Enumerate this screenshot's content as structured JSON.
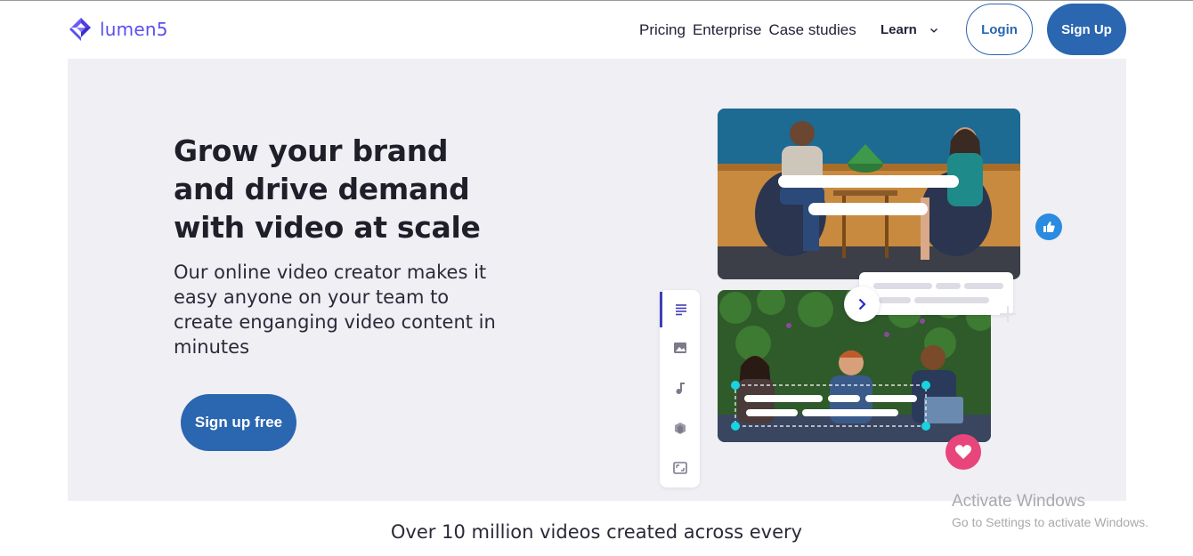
{
  "brand": {
    "name": "lumen5",
    "color": "#5a4ff2"
  },
  "nav": {
    "links": [
      "Pricing",
      "Enterprise",
      "Case studies"
    ],
    "learn": "Learn",
    "login": "Login",
    "signup": "Sign Up"
  },
  "hero": {
    "title_lines": [
      "Grow your brand",
      "and drive demand",
      "with video at scale"
    ],
    "subtitle": "Our online video creator makes it easy anyone on your team to create enganging video content in minutes",
    "cta": "Sign up free"
  },
  "editor_tools": [
    "text-lines-icon",
    "image-icon",
    "music-note-icon",
    "layers-icon",
    "resize-icon"
  ],
  "watermark": {
    "title": "Activate Windows",
    "subtitle": "Go to Settings to activate Windows."
  },
  "tagline": "Over 10 million videos created across every",
  "colors": {
    "primary": "#2b66b0",
    "hero_bg": "#f0eff4",
    "like": "#2a8be0",
    "heart": "#e8457a",
    "handle": "#19d3e0"
  }
}
